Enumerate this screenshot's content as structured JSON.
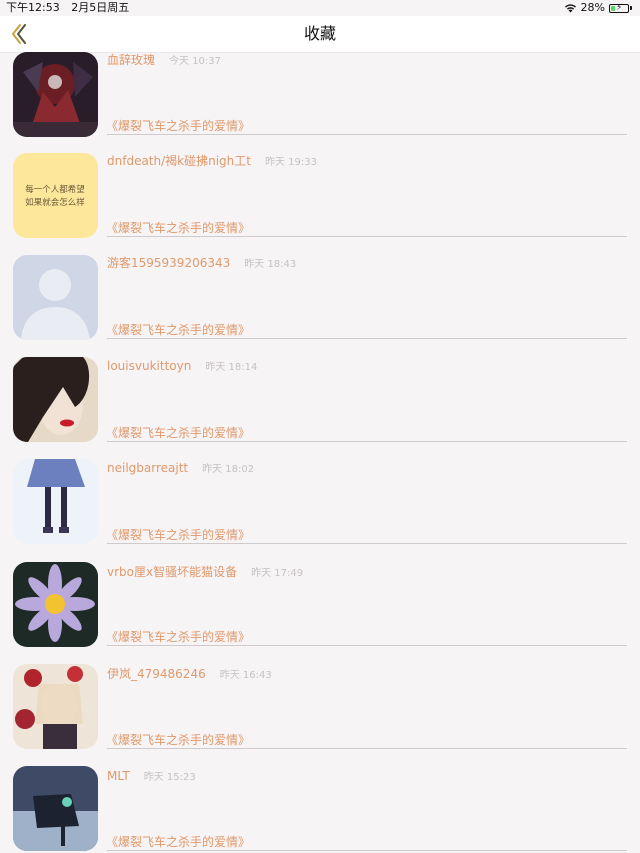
{
  "status_bar": {
    "time": "下午12:53",
    "date": "2月5日周五",
    "battery_percent": "28%",
    "battery_level": 0.28
  },
  "nav": {
    "title": "收藏",
    "back_icon": "chevron-left-icon",
    "accent_color": "#c8a23c"
  },
  "colors": {
    "name": "#e0996b",
    "time": "#c6c2c4",
    "work": "#e0996b",
    "background": "#f7f4f6"
  },
  "items": [
    {
      "username": "血辞玫瑰",
      "time": "今天 10:37",
      "work": "《爆裂飞车之杀手的爱情》",
      "avatar": "dark-red-gothic-avatar"
    },
    {
      "username": "dnfdeath/褐k碰拂nigh工t",
      "time": "昨天 19:33",
      "work": "《爆裂飞车之杀手的爱情》",
      "avatar": "yellow-text-avatar",
      "avatar_text": [
        "每一个人都希望",
        "如果就会怎么样"
      ]
    },
    {
      "username": "游客1595939206343",
      "time": "昨天 18:43",
      "work": "《爆裂飞车之杀手的爱情》",
      "avatar": "default-person-avatar"
    },
    {
      "username": "louisvukittoyn",
      "time": "昨天 18:14",
      "work": "《爆裂飞车之杀手的爱情》",
      "avatar": "dark-hair-portrait-avatar"
    },
    {
      "username": "neilgbarreajtt",
      "time": "昨天 18:02",
      "work": "《爆裂飞车之杀手的爱情》",
      "avatar": "anime-school-uniform-avatar"
    },
    {
      "username": "vrbo厘x智骚坏能猫设备",
      "time": "昨天 17:49",
      "work": "《爆裂飞车之杀手的爱情》",
      "avatar": "water-lily-avatar"
    },
    {
      "username": "伊岚_479486246",
      "time": "昨天 16:43",
      "work": "《爆裂飞车之杀手的爱情》",
      "avatar": "anime-red-flowers-avatar"
    },
    {
      "username": "MLT",
      "time": "昨天 15:23",
      "work": "《爆裂飞车之杀手的爱情》",
      "avatar": "dark-night-scene-avatar"
    }
  ]
}
